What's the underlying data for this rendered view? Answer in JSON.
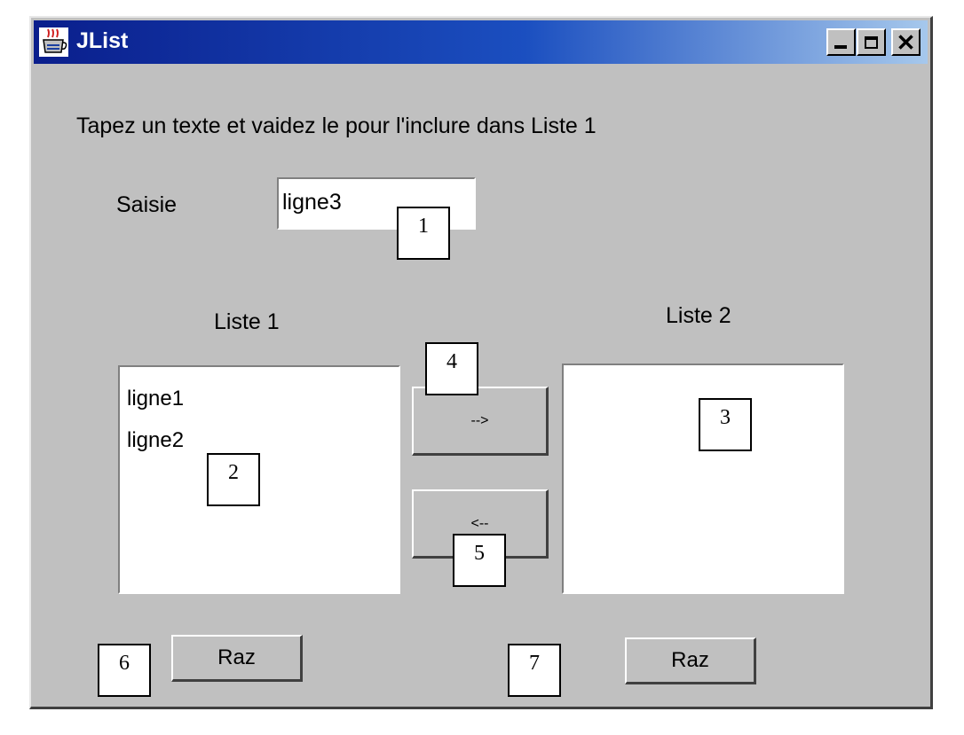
{
  "window": {
    "title": "JList",
    "controls": {
      "minimize": "minimize-icon",
      "maximize": "maximize-icon",
      "close": "close-icon"
    },
    "colors": {
      "title_start": "#0a1e8c",
      "title_end": "#a6c8ec",
      "face": "#c0c0c0"
    }
  },
  "form": {
    "instruction": "Tapez un texte et vaidez le pour l'inclure dans Liste 1",
    "saisie_label": "Saisie",
    "saisie_value": "ligne3"
  },
  "lists": {
    "list1": {
      "label": "Liste 1",
      "items": [
        "ligne1",
        "ligne2"
      ]
    },
    "list2": {
      "label": "Liste 2",
      "items": []
    }
  },
  "buttons": {
    "move_right": "-->",
    "move_left": "<--",
    "raz1": "Raz",
    "raz2": "Raz"
  },
  "callouts": {
    "c1": "1",
    "c2": "2",
    "c3": "3",
    "c4": "4",
    "c5": "5",
    "c6": "6",
    "c7": "7"
  }
}
